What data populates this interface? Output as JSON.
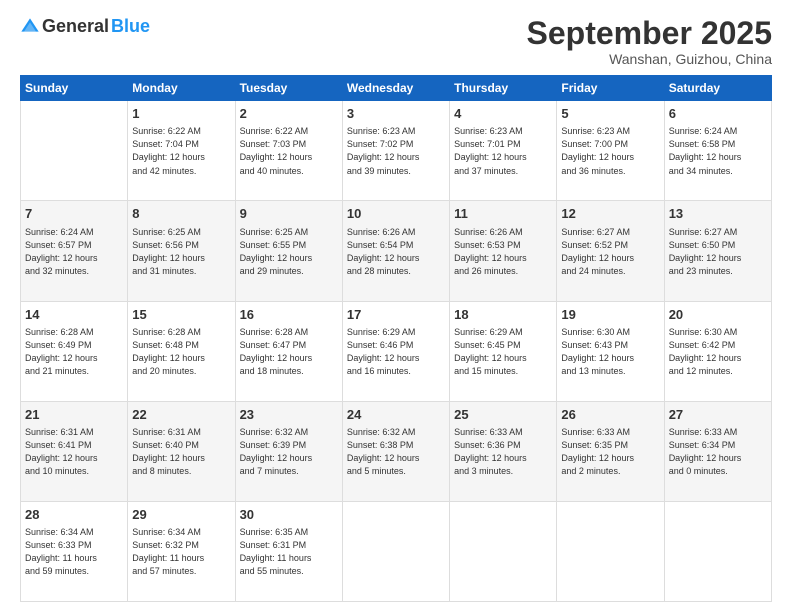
{
  "header": {
    "logo_general": "General",
    "logo_blue": "Blue",
    "month": "September 2025",
    "location": "Wanshan, Guizhou, China"
  },
  "days_of_week": [
    "Sunday",
    "Monday",
    "Tuesday",
    "Wednesday",
    "Thursday",
    "Friday",
    "Saturday"
  ],
  "weeks": [
    [
      {
        "day": "",
        "info": ""
      },
      {
        "day": "1",
        "info": "Sunrise: 6:22 AM\nSunset: 7:04 PM\nDaylight: 12 hours\nand 42 minutes."
      },
      {
        "day": "2",
        "info": "Sunrise: 6:22 AM\nSunset: 7:03 PM\nDaylight: 12 hours\nand 40 minutes."
      },
      {
        "day": "3",
        "info": "Sunrise: 6:23 AM\nSunset: 7:02 PM\nDaylight: 12 hours\nand 39 minutes."
      },
      {
        "day": "4",
        "info": "Sunrise: 6:23 AM\nSunset: 7:01 PM\nDaylight: 12 hours\nand 37 minutes."
      },
      {
        "day": "5",
        "info": "Sunrise: 6:23 AM\nSunset: 7:00 PM\nDaylight: 12 hours\nand 36 minutes."
      },
      {
        "day": "6",
        "info": "Sunrise: 6:24 AM\nSunset: 6:58 PM\nDaylight: 12 hours\nand 34 minutes."
      }
    ],
    [
      {
        "day": "7",
        "info": "Sunrise: 6:24 AM\nSunset: 6:57 PM\nDaylight: 12 hours\nand 32 minutes."
      },
      {
        "day": "8",
        "info": "Sunrise: 6:25 AM\nSunset: 6:56 PM\nDaylight: 12 hours\nand 31 minutes."
      },
      {
        "day": "9",
        "info": "Sunrise: 6:25 AM\nSunset: 6:55 PM\nDaylight: 12 hours\nand 29 minutes."
      },
      {
        "day": "10",
        "info": "Sunrise: 6:26 AM\nSunset: 6:54 PM\nDaylight: 12 hours\nand 28 minutes."
      },
      {
        "day": "11",
        "info": "Sunrise: 6:26 AM\nSunset: 6:53 PM\nDaylight: 12 hours\nand 26 minutes."
      },
      {
        "day": "12",
        "info": "Sunrise: 6:27 AM\nSunset: 6:52 PM\nDaylight: 12 hours\nand 24 minutes."
      },
      {
        "day": "13",
        "info": "Sunrise: 6:27 AM\nSunset: 6:50 PM\nDaylight: 12 hours\nand 23 minutes."
      }
    ],
    [
      {
        "day": "14",
        "info": "Sunrise: 6:28 AM\nSunset: 6:49 PM\nDaylight: 12 hours\nand 21 minutes."
      },
      {
        "day": "15",
        "info": "Sunrise: 6:28 AM\nSunset: 6:48 PM\nDaylight: 12 hours\nand 20 minutes."
      },
      {
        "day": "16",
        "info": "Sunrise: 6:28 AM\nSunset: 6:47 PM\nDaylight: 12 hours\nand 18 minutes."
      },
      {
        "day": "17",
        "info": "Sunrise: 6:29 AM\nSunset: 6:46 PM\nDaylight: 12 hours\nand 16 minutes."
      },
      {
        "day": "18",
        "info": "Sunrise: 6:29 AM\nSunset: 6:45 PM\nDaylight: 12 hours\nand 15 minutes."
      },
      {
        "day": "19",
        "info": "Sunrise: 6:30 AM\nSunset: 6:43 PM\nDaylight: 12 hours\nand 13 minutes."
      },
      {
        "day": "20",
        "info": "Sunrise: 6:30 AM\nSunset: 6:42 PM\nDaylight: 12 hours\nand 12 minutes."
      }
    ],
    [
      {
        "day": "21",
        "info": "Sunrise: 6:31 AM\nSunset: 6:41 PM\nDaylight: 12 hours\nand 10 minutes."
      },
      {
        "day": "22",
        "info": "Sunrise: 6:31 AM\nSunset: 6:40 PM\nDaylight: 12 hours\nand 8 minutes."
      },
      {
        "day": "23",
        "info": "Sunrise: 6:32 AM\nSunset: 6:39 PM\nDaylight: 12 hours\nand 7 minutes."
      },
      {
        "day": "24",
        "info": "Sunrise: 6:32 AM\nSunset: 6:38 PM\nDaylight: 12 hours\nand 5 minutes."
      },
      {
        "day": "25",
        "info": "Sunrise: 6:33 AM\nSunset: 6:36 PM\nDaylight: 12 hours\nand 3 minutes."
      },
      {
        "day": "26",
        "info": "Sunrise: 6:33 AM\nSunset: 6:35 PM\nDaylight: 12 hours\nand 2 minutes."
      },
      {
        "day": "27",
        "info": "Sunrise: 6:33 AM\nSunset: 6:34 PM\nDaylight: 12 hours\nand 0 minutes."
      }
    ],
    [
      {
        "day": "28",
        "info": "Sunrise: 6:34 AM\nSunset: 6:33 PM\nDaylight: 11 hours\nand 59 minutes."
      },
      {
        "day": "29",
        "info": "Sunrise: 6:34 AM\nSunset: 6:32 PM\nDaylight: 11 hours\nand 57 minutes."
      },
      {
        "day": "30",
        "info": "Sunrise: 6:35 AM\nSunset: 6:31 PM\nDaylight: 11 hours\nand 55 minutes."
      },
      {
        "day": "",
        "info": ""
      },
      {
        "day": "",
        "info": ""
      },
      {
        "day": "",
        "info": ""
      },
      {
        "day": "",
        "info": ""
      }
    ]
  ]
}
